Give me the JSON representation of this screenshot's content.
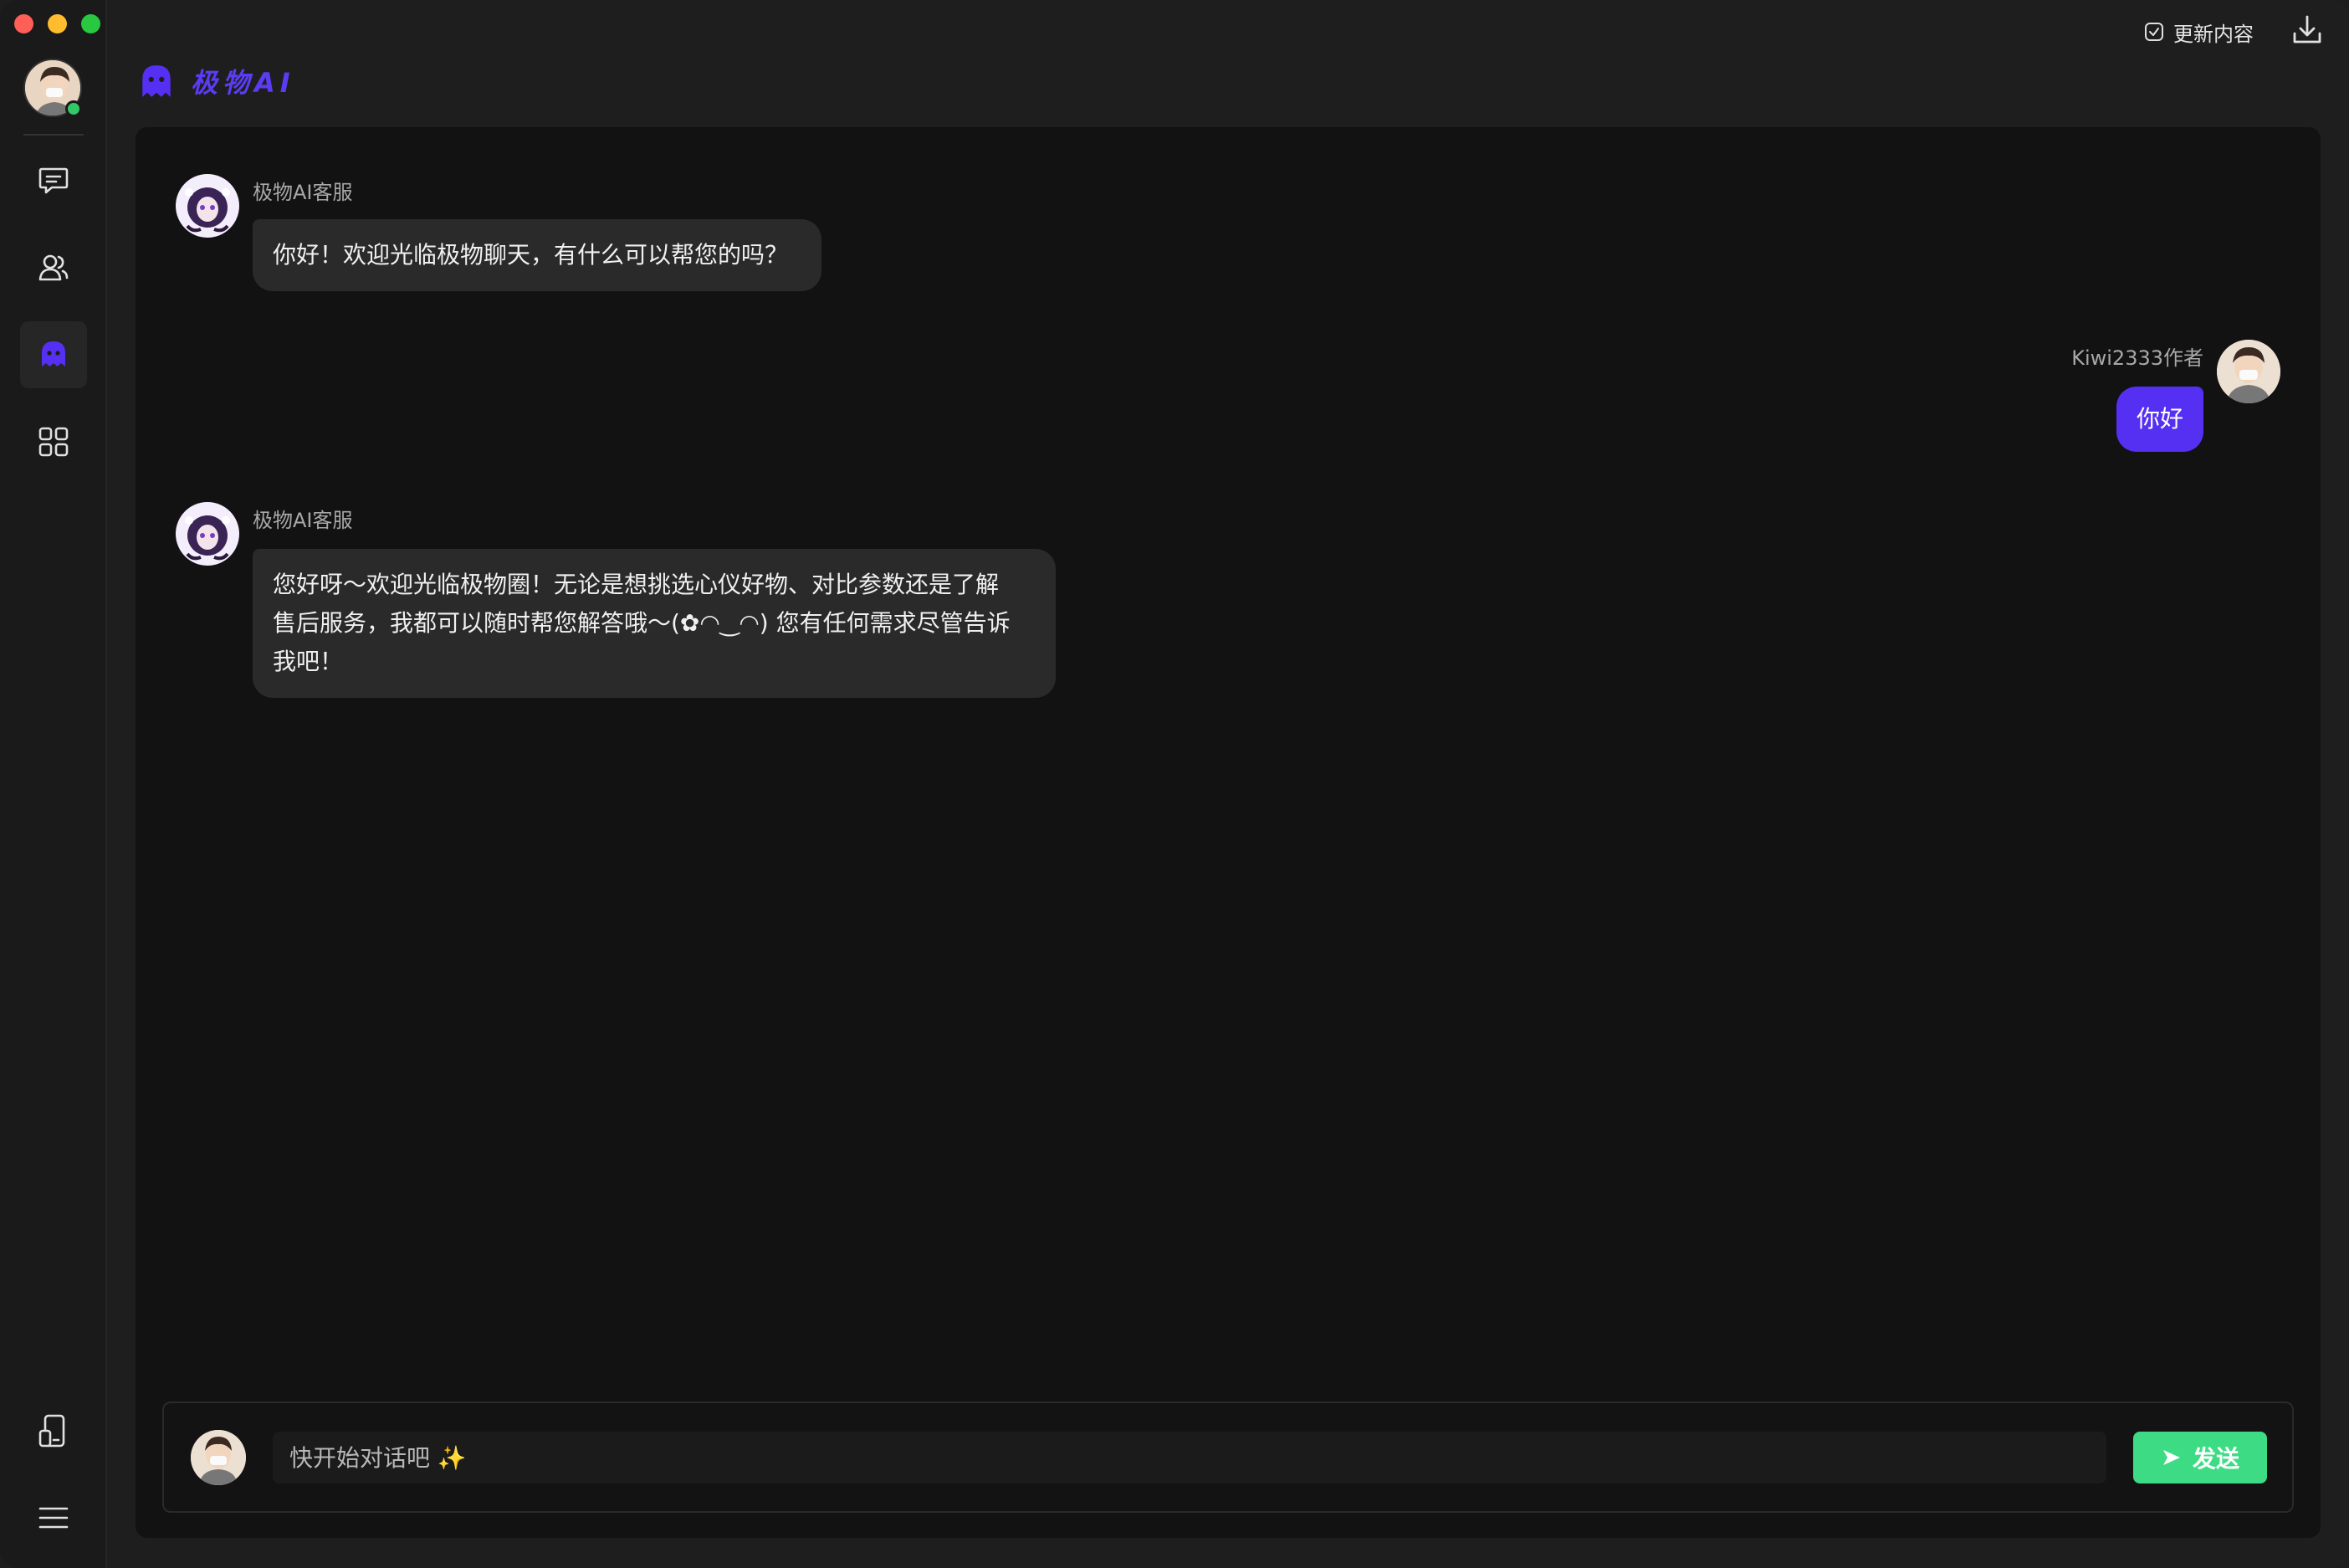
{
  "app": {
    "brand_title": "极物AI"
  },
  "topbar": {
    "update_label": "更新内容"
  },
  "sidebar": {
    "items": [
      {
        "name": "messages",
        "icon": "chat-bubble-icon",
        "active": false
      },
      {
        "name": "contacts",
        "icon": "contacts-icon",
        "active": false
      },
      {
        "name": "ai-assistant",
        "icon": "ghost-icon",
        "active": true
      },
      {
        "name": "apps",
        "icon": "grid-icon",
        "active": false
      }
    ],
    "bottom": [
      {
        "name": "device",
        "icon": "device-icon"
      },
      {
        "name": "menu",
        "icon": "hamburger-menu-icon"
      }
    ]
  },
  "conversation": {
    "messages": [
      {
        "role": "bot",
        "sender": "极物AI客服",
        "text": "你好！欢迎光临极物聊天，有什么可以帮您的吗？"
      },
      {
        "role": "user",
        "sender": "Kiwi2333作者",
        "text": "你好"
      },
      {
        "role": "bot",
        "sender": "极物AI客服",
        "lines": [
          "您好呀～欢迎光临极物圈！无论是想挑选心仪好物、对比参数还是了解",
          "售后服务，我都可以随时帮您解答哦～(✿◠‿◠) 您有任何需求尽管告诉",
          "我吧！"
        ]
      }
    ]
  },
  "composer": {
    "placeholder": "快开始对话吧 ✨",
    "send_label": "发送"
  },
  "colors": {
    "accent": "#5630f2",
    "send": "#3ddc84",
    "online": "#33c767"
  }
}
